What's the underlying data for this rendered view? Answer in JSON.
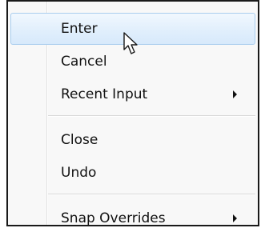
{
  "menu": {
    "items": [
      {
        "label": "Enter",
        "state": "hover"
      },
      {
        "label": "Cancel"
      },
      {
        "label": "Recent Input",
        "submenu_icon": "chevron-right-icon"
      },
      {
        "label": "Close"
      },
      {
        "label": "Undo"
      },
      {
        "label": "Snap Overrides",
        "submenu_icon": "chevron-right-icon"
      }
    ],
    "colors": {
      "hover_border": "#a9cdee",
      "hover_fill": "#dceafa",
      "background": "#f8f8f8",
      "frame": "#1a1a1a"
    }
  },
  "cursor": {
    "icon": "mouse-pointer-icon"
  }
}
